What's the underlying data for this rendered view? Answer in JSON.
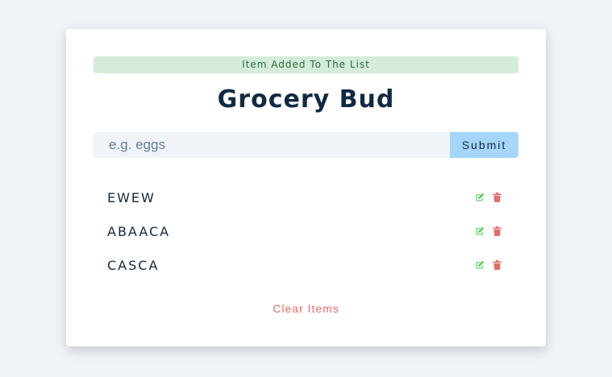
{
  "alert": {
    "text": "Item Added To The List",
    "color": "#d4ecd9"
  },
  "app": {
    "title": "Grocery Bud"
  },
  "form": {
    "placeholder": "e.g. eggs",
    "value": "",
    "submit_label": "Submit",
    "submit_color": "#a5d5f8"
  },
  "items": [
    {
      "title": "EWEW",
      "edit_icon": "edit-icon",
      "delete_icon": "trash-icon"
    },
    {
      "title": "ABAACA",
      "edit_icon": "edit-icon",
      "delete_icon": "trash-icon"
    },
    {
      "title": "CASCA",
      "edit_icon": "edit-icon",
      "delete_icon": "trash-icon"
    }
  ],
  "clear": {
    "label": "Clear Items",
    "color": "#e66b6b"
  },
  "colors": {
    "edit": "#5ad166",
    "delete": "#e66b6b",
    "title": "#102a43"
  }
}
